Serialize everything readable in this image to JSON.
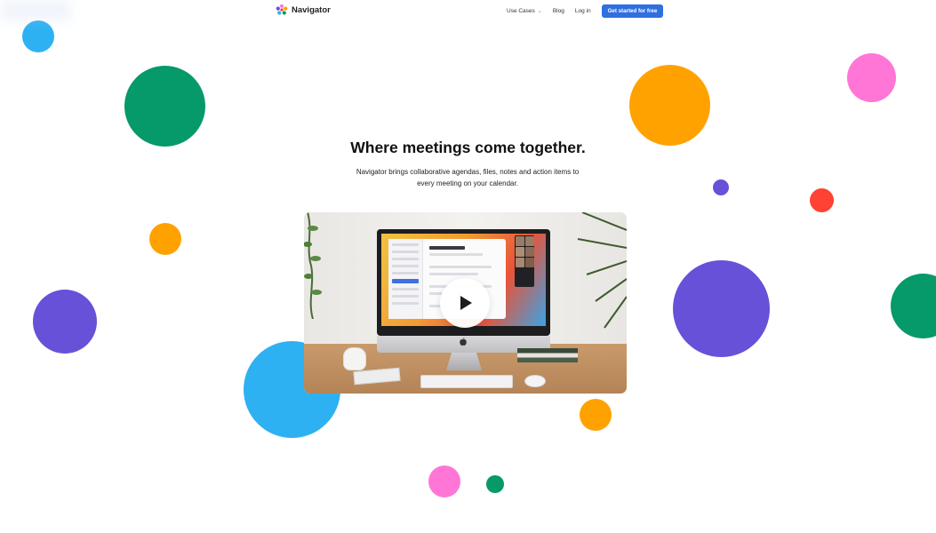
{
  "nav": {
    "brand_name": "Navigator",
    "links": [
      {
        "label": "Use Cases",
        "has_dropdown": true
      },
      {
        "label": "Blog"
      },
      {
        "label": "Log in"
      }
    ],
    "cta_label": "Get started for free"
  },
  "hero": {
    "title": "Where meetings come together.",
    "subtitle_line1": "Navigator brings collaborative agendas, files, notes and action items to",
    "subtitle_line2": "every meeting on your calendar."
  },
  "video": {
    "icon": "play-icon"
  },
  "colors": {
    "cta_blue": "#2f6fe0",
    "sky_blue": "#2eb1f3",
    "green": "#06996a",
    "orange": "#ffa200",
    "pink": "#ff76d7",
    "purple": "#6751d9",
    "red": "#ff4233"
  }
}
